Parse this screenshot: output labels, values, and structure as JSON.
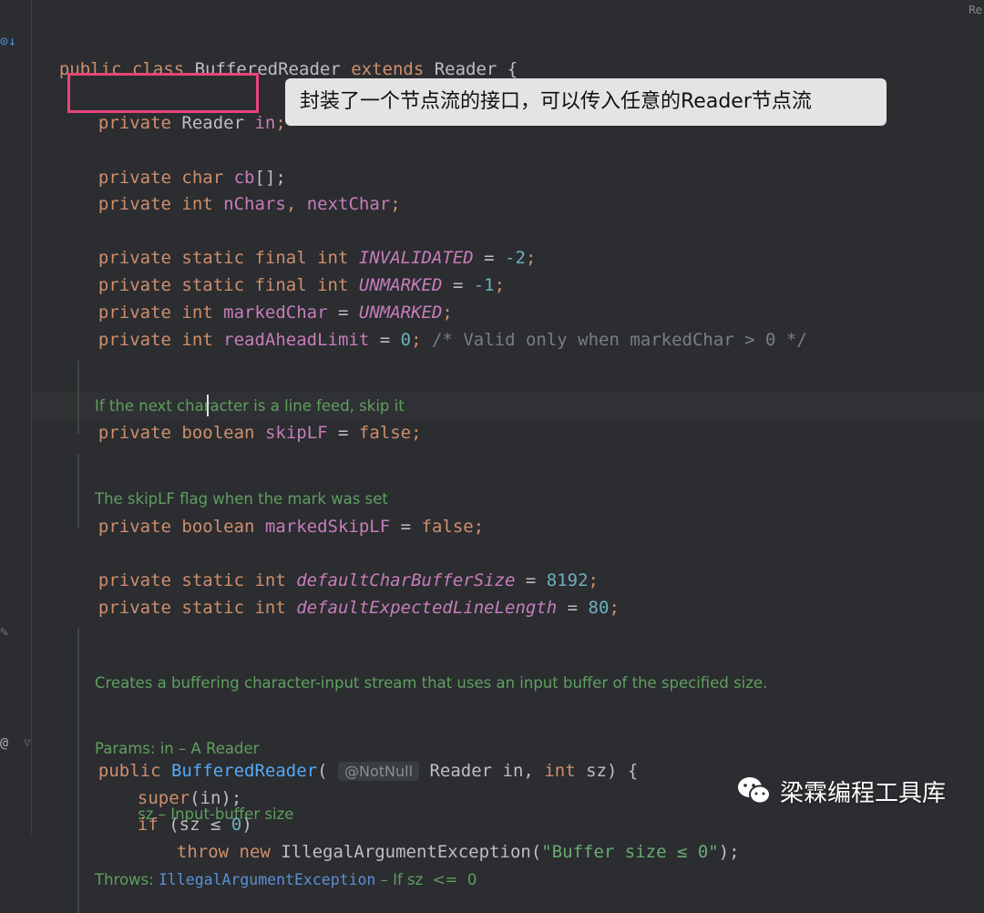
{
  "corner_label": "Re",
  "tooltip": "封装了一个节点流的接口，可以传入任意的Reader节点流",
  "watermark": "梁霖编程工具库",
  "code": {
    "l1": {
      "a": "public class ",
      "b": "BufferedReader ",
      "c": "extends ",
      "d": "Reader {"
    },
    "l2": {
      "a": "private ",
      "b": "Reader ",
      "c": "in",
      "d": ";"
    },
    "l3": {
      "a": "private ",
      "b": "char ",
      "c": "cb",
      "d": "[];"
    },
    "l4": {
      "a": "private ",
      "b": "int ",
      "c": "nChars",
      "d": ", ",
      "e": "nextChar",
      "f": ";"
    },
    "l5": {
      "a": "private static final int ",
      "b": "INVALIDATED",
      "c": " = ",
      "d": "-2",
      "e": ";"
    },
    "l6": {
      "a": "private static final int ",
      "b": "UNMARKED",
      "c": " = ",
      "d": "-1",
      "e": ";"
    },
    "l7": {
      "a": "private ",
      "b": "int ",
      "c": "markedChar",
      "d": " = ",
      "e": "UNMARKED",
      "f": ";"
    },
    "l8": {
      "a": "private ",
      "b": "int ",
      "c": "readAheadLimit",
      "d": " = ",
      "e": "0",
      "f": "; ",
      "g": "/* Valid only when markedChar > 0 */"
    },
    "doc1": "If the next character is a line feed, skip it",
    "l9": {
      "a": "private ",
      "b": "boole",
      "c": "an ",
      "d": "skipLF",
      "e": " = ",
      "f": "false",
      "g": ";"
    },
    "doc2": "The skipLF flag when the mark was set",
    "l10": {
      "a": "private ",
      "b": "boolean ",
      "c": "markedSkipLF",
      "d": " = ",
      "e": "false",
      "f": ";"
    },
    "l11": {
      "a": "private static int ",
      "b": "defaultCharBufferSize",
      "c": " = ",
      "d": "8192",
      "e": ";"
    },
    "l12": {
      "a": "private static int ",
      "b": "defaultExpectedLineLength",
      "c": " = ",
      "d": "80",
      "e": ";"
    },
    "doc3": {
      "r1": "Creates a buffering character-input stream that uses an input buffer of the specified size.",
      "r2": "Params: in – A Reader",
      "r3": "         sz – Input-buffer size",
      "r4a": "Throws: ",
      "r4b": "IllegalArgumentException",
      "r4c": " – If sz  <=  0"
    },
    "l13": {
      "a": "public ",
      "b": "BufferedReader",
      "c": "( ",
      "d": "@NotNull",
      "e": " Reader in, ",
      "f": "int ",
      "g": "sz) {"
    },
    "l14": {
      "a": "super",
      "b": "(in);"
    },
    "l15": {
      "a": "if ",
      "b": "(sz ≤ ",
      "c": "0",
      "d": ")"
    },
    "l16": {
      "a": "throw new ",
      "b": "IllegalArgumentException(",
      "c": "\"Buffer size ≤ 0\"",
      "d": ");"
    }
  },
  "colors": {
    "background": "#2b2d30",
    "keyword": "#cf8e6d",
    "field": "#c77dbb",
    "number": "#6fafbd",
    "string": "#6aab73",
    "doc": "#5f9f5f",
    "highlight": "#e8457a"
  },
  "icons": [
    "override-indicator-icon",
    "edit-icon",
    "at-annotation-icon",
    "bookmark-icon",
    "wechat-icon"
  ]
}
